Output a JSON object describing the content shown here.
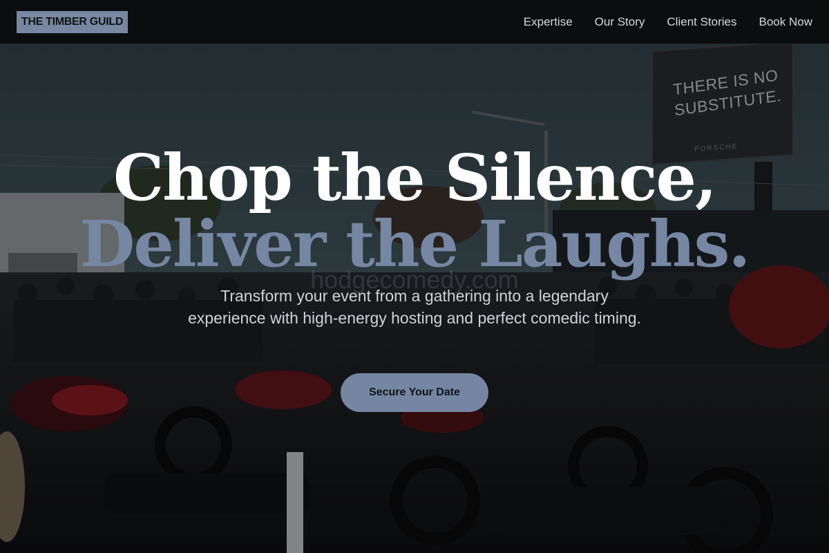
{
  "header": {
    "logo": "THE TIMBER GUILD",
    "nav": [
      "Expertise",
      "Our Story",
      "Client Stories",
      "Book Now"
    ]
  },
  "hero": {
    "title_line1": "Chop the Silence,",
    "title_line2": "Deliver the Laughs.",
    "subtitle": "Transform your event from a gathering into a legendary experience with high-energy hosting and perfect comedic timing.",
    "cta": "Secure Your Date",
    "watermark": "hodgecomedy.com",
    "billboard_text": "THERE IS NO SUBSTITUTE.",
    "billboard_brand": "PORSCHE"
  },
  "colors": {
    "accent": "#7586a2",
    "header_bg": "#0b0d0e",
    "title_primary": "#ffffff",
    "title_secondary": "#7687a3"
  }
}
